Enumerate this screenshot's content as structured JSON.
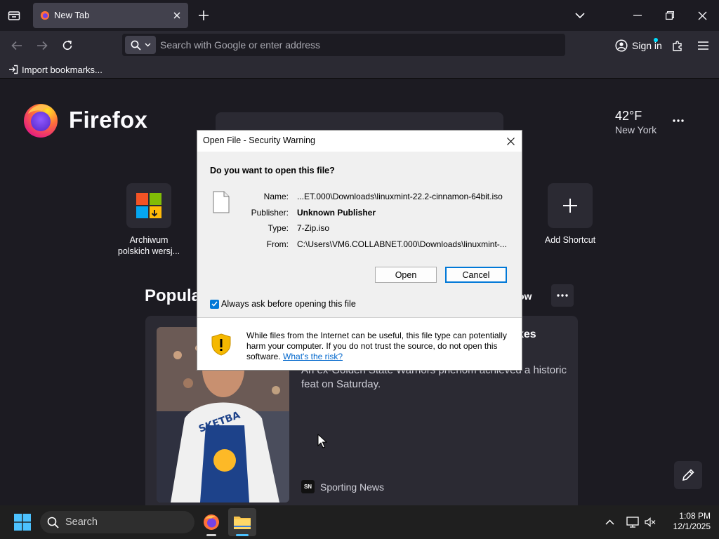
{
  "browser": {
    "tab": {
      "title": "New Tab"
    },
    "urlbar": {
      "placeholder": "Search with Google or enter address"
    },
    "signin_label": "Sign in",
    "bookmarks": {
      "import_label": "Import bookmarks..."
    }
  },
  "newtab": {
    "brand": "Firefox",
    "weather": {
      "temp": "42°F",
      "city": "New York"
    },
    "shortcuts": [
      {
        "label": "Archiwum polskich wersj...",
        "icon": "windows-logo-icon"
      },
      {
        "label": "Add Shortcut",
        "icon": "plus-icon"
      }
    ],
    "popular": {
      "title": "Popula",
      "follow_partial": "ow"
    },
    "story": {
      "title_partial": "kes",
      "excerpt": "An ex-Golden State Warriors phenom achieved a historic feat on Saturday.",
      "source": "Sporting News",
      "source_badge": "SN"
    }
  },
  "dialog": {
    "title": "Open File - Security Warning",
    "question": "Do you want to open this file?",
    "fields": [
      {
        "label": "Name:",
        "value": "...ET.000\\Downloads\\linuxmint-22.2-cinnamon-64bit.iso"
      },
      {
        "label": "Publisher:",
        "value": "Unknown Publisher"
      },
      {
        "label": "Type:",
        "value": "7-Zip.iso"
      },
      {
        "label": "From:",
        "value": "C:\\Users\\VM6.COLLABNET.000\\Downloads\\linuxmint-..."
      }
    ],
    "open_label": "Open",
    "cancel_label": "Cancel",
    "always_ask_label": "Always ask before opening this file",
    "always_ask_checked": true,
    "warning_text": "While files from the Internet can be useful, this file type can potentially harm your computer. If you do not trust the source, do not open this software.",
    "risk_link": "What's the risk?"
  },
  "taskbar": {
    "search_label": "Search",
    "time": "1:08 PM",
    "date": "12/1/2025"
  },
  "colors": {
    "accent": "#0078d7",
    "browser_bg": "#1c1b22",
    "toolbar_bg": "#2b2a33",
    "link": "#0066cc",
    "shield_yellow": "#f5b800"
  }
}
